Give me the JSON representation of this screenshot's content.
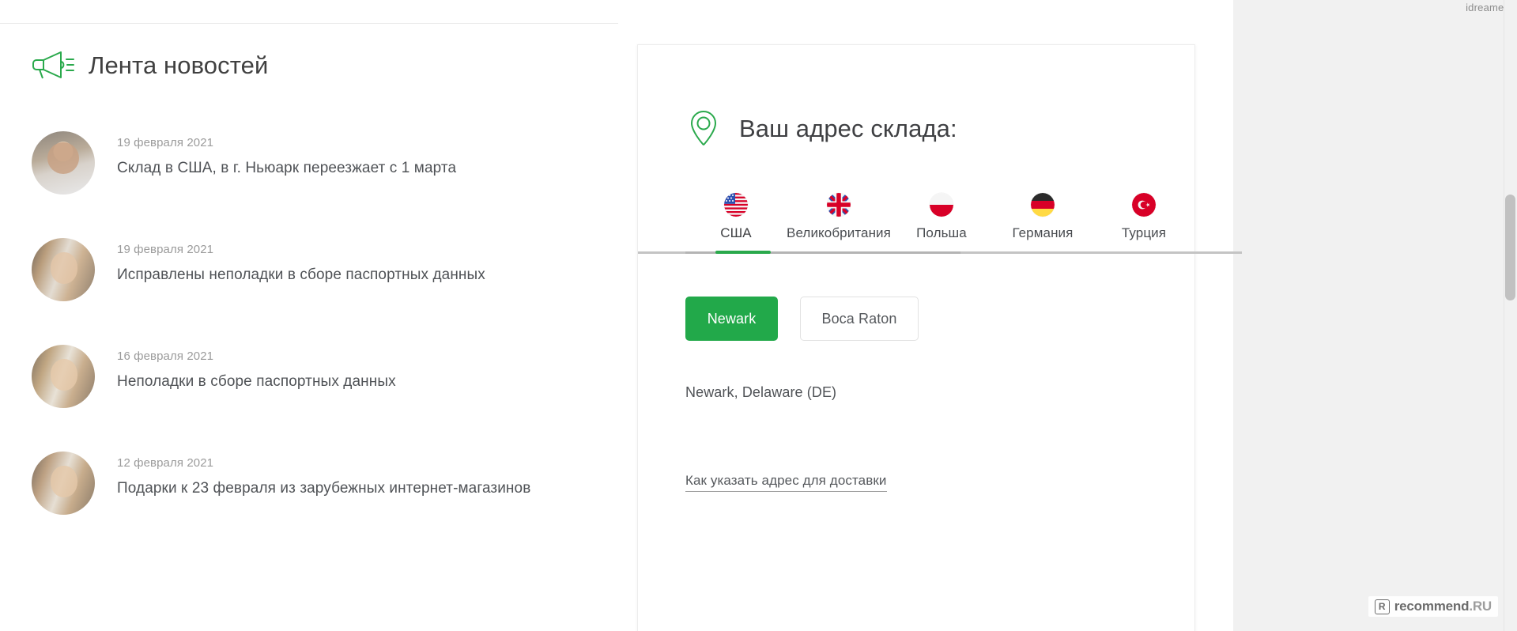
{
  "watermark_top": "idreamer",
  "news": {
    "heading": "Лента новостей",
    "icon": "megaphone-icon",
    "items": [
      {
        "date": "19 февраля 2021",
        "title": "Склад в США, в г. Ньюарк переезжает с 1 марта"
      },
      {
        "date": "19 февраля 2021",
        "title": "Исправлены неполадки в сборе паспортных данных"
      },
      {
        "date": "16 февраля 2021",
        "title": "Неполадки в сборе паспортных данных"
      },
      {
        "date": "12 февраля 2021",
        "title": "Подарки к 23 февраля из зарубежных интернет-магазинов"
      }
    ]
  },
  "warehouse_card": {
    "icon": "location-pin-icon",
    "title": "Ваш адрес склада:",
    "tabs": [
      {
        "label": "США",
        "flag": "flag-usa",
        "active": true
      },
      {
        "label": "Великобритания",
        "flag": "flag-uk",
        "active": false
      },
      {
        "label": "Польша",
        "flag": "flag-poland",
        "active": false
      },
      {
        "label": "Германия",
        "flag": "flag-germany",
        "active": false
      },
      {
        "label": "Турция",
        "flag": "flag-turkey",
        "active": false
      }
    ],
    "city_buttons": [
      {
        "label": "Newark",
        "selected": true
      },
      {
        "label": "Boca Raton",
        "selected": false
      }
    ],
    "address": "Newark, Delaware (DE)",
    "howto_link": "Как указать адрес для доставки"
  },
  "watermark_bottom": {
    "badge": "R",
    "text_strong": "recommend",
    "text_dim": ".RU"
  },
  "colors": {
    "accent_green": "#22a94a",
    "heading_text": "#3f4043",
    "muted_text": "#9b9b9b",
    "body_text": "#4f5256"
  }
}
